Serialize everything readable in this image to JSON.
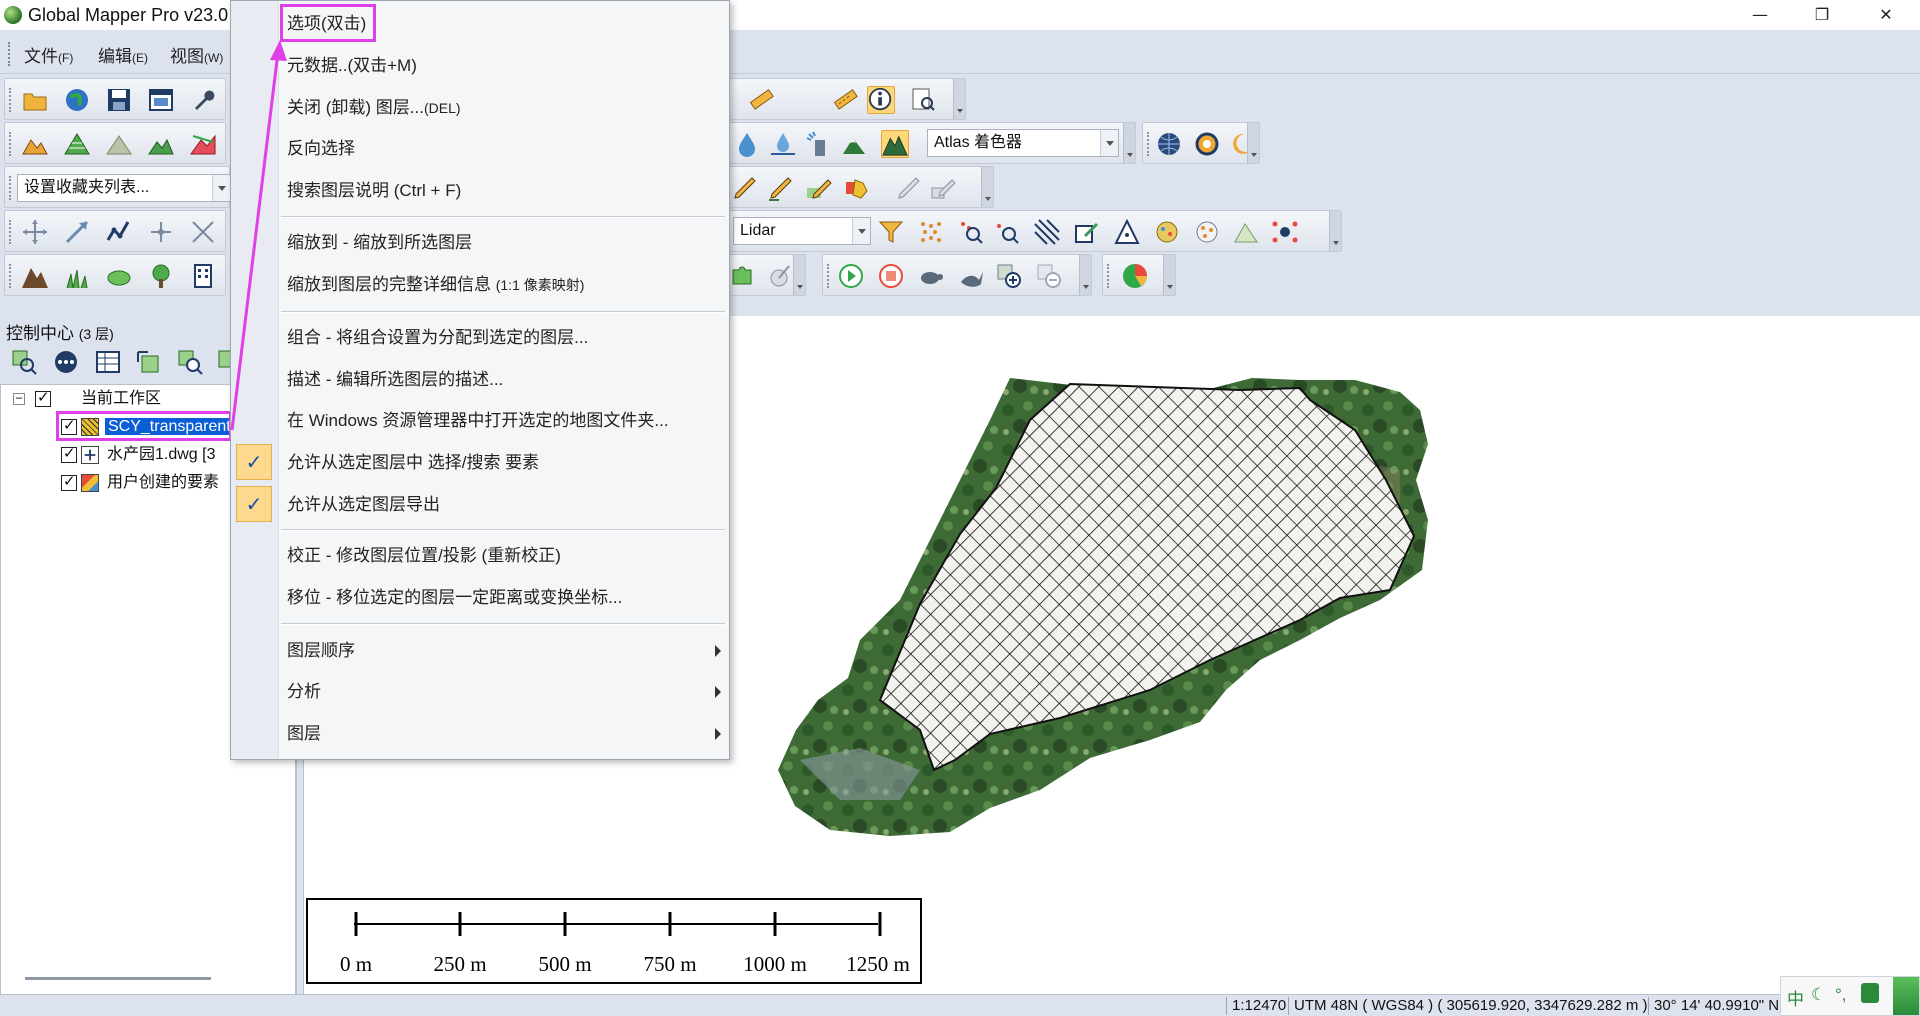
{
  "window": {
    "title": "Global Mapper Pro v23.0",
    "minimize": "—",
    "restore": "❐",
    "close": "✕"
  },
  "menubar": {
    "file": "文件",
    "file_key": "(F)",
    "edit": "编辑",
    "edit_key": "(E)",
    "view": "视图",
    "view_key": "(W)"
  },
  "toolbars": {
    "favorites_combo": "设置收藏夹列表...",
    "shader_combo": "Atlas 着色器",
    "lidar_combo": "Lidar"
  },
  "control_center": {
    "title": "控制中心",
    "layer_count": "(3 层)",
    "tree": {
      "workspace": "当前工作区",
      "layers": [
        {
          "label": "SCY_transparent",
          "checked": true,
          "selected": true
        },
        {
          "label": "水产园1.dwg [3",
          "checked": true,
          "selected": false
        },
        {
          "label": "用户创建的要素",
          "checked": true,
          "selected": false
        }
      ]
    }
  },
  "context_menu": {
    "items": [
      {
        "label": "选项(双击)"
      },
      {
        "label": "元数据..(双击+M)"
      },
      {
        "label": "关闭 (卸载) 图层...",
        "suffix": "(DEL)"
      },
      {
        "label": "反向选择"
      },
      {
        "label": "搜索图层说明 (Ctrl + F)"
      },
      {
        "label": "缩放到 - 缩放到所选图层"
      },
      {
        "label": "缩放到图层的完整详细信息",
        "suffix": "(1:1 像素映射)"
      },
      {
        "label": "组合 - 将组合设置为分配到选定的图层..."
      },
      {
        "label": "描述 - 编辑所选图层的描述..."
      },
      {
        "label": "在 Windows 资源管理器中打开选定的地图文件夹..."
      },
      {
        "label": "允许从选定图层中 选择/搜索 要素",
        "checked": true
      },
      {
        "label": "允许从选定图层导出",
        "checked": true
      },
      {
        "label": "校正 - 修改图层位置/投影 (重新校正)"
      },
      {
        "label": "移位 - 移位选定的图层一定距离或变换坐标..."
      },
      {
        "label": "图层顺序",
        "submenu": true
      },
      {
        "label": "分析",
        "submenu": true
      },
      {
        "label": "图层",
        "submenu": true
      }
    ],
    "check_glyph": "✓"
  },
  "scale_bar": {
    "labels": [
      "0 m",
      "250 m",
      "500 m",
      "750 m",
      "1000 m",
      "1250 m"
    ]
  },
  "status_bar": {
    "scale": "1:12470",
    "projection": "UTM 48N ( WGS84 ) ( 305619.920, 3347629.282 m )",
    "latlon": "30° 14' 40.9910\" N"
  },
  "ime": {
    "chinese": "中",
    "moon": "☾",
    "dot": "°,",
    "shirt": "👕"
  },
  "colors": {
    "highlight_box": "#e040e8",
    "selection": "#0a5fd6",
    "check_bg": "#fcd98e",
    "toolbar_bg": "#dde3ee"
  }
}
